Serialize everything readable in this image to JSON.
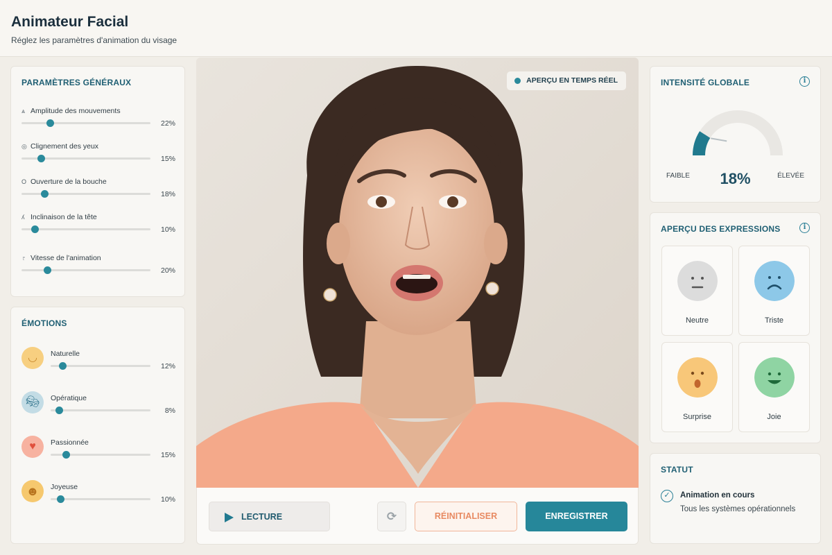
{
  "header": {
    "title": "Animateur Facial",
    "subtitle": "Réglez les paramètres d'animation du visage"
  },
  "general": {
    "title": "PARAMÈTRES GÉNÉRAUX",
    "params": [
      {
        "label": "Amplitude des mouvements",
        "value_text": "22%",
        "value": 22,
        "icon": "amplitude-icon"
      },
      {
        "label": "Clignement des yeux",
        "value_text": "15%",
        "value": 15,
        "icon": "eye-icon"
      },
      {
        "label": "Ouverture de la bouche",
        "value_text": "18%",
        "value": 18,
        "icon": "mouth-icon"
      },
      {
        "label": "Inclinaison de la tête",
        "value_text": "10%",
        "value": 10,
        "icon": "head-tilt-icon"
      },
      {
        "label": "Vitesse de l'animation",
        "value_text": "20%",
        "value": 20,
        "icon": "speed-icon"
      }
    ]
  },
  "emotions": {
    "title": "ÉMOTIONS",
    "items": [
      {
        "label": "Naturelle",
        "value_text": "12%",
        "value": 12,
        "icon": "smile-icon",
        "color": "#f7c875"
      },
      {
        "label": "Opératique",
        "value_text": "8%",
        "value": 8,
        "icon": "theater-masks-icon",
        "color": "#b9d6e0"
      },
      {
        "label": "Passionnée",
        "value_text": "15%",
        "value": 15,
        "icon": "heart-icon",
        "color": "#f6a58f"
      },
      {
        "label": "Joyeuse",
        "value_text": "10%",
        "value": 10,
        "icon": "grin-icon",
        "color": "#f7c46b"
      }
    ]
  },
  "viewer": {
    "badge": "APERÇU EN TEMPS RÉEL",
    "image_alt": "portrait-photo"
  },
  "controls": {
    "play": "LECTURE",
    "reset": "RÉINITIALISER",
    "save": "ENREGISTRER"
  },
  "intensity": {
    "title": "INTENSITÉ GLOBALE",
    "low": "FAIBLE",
    "high": "ÉLEVÉE",
    "value_text": "18%",
    "value": 18
  },
  "expressions": {
    "title": "APERÇU DES EXPRESSIONS",
    "items": [
      {
        "label": "Neutre",
        "color": "#dcdcdc",
        "icon": "neutral-face-icon"
      },
      {
        "label": "Triste",
        "color": "#8dc8e8",
        "icon": "sad-face-icon"
      },
      {
        "label": "Surprise",
        "color": "#f8c779",
        "icon": "surprised-face-icon"
      },
      {
        "label": "Joie",
        "color": "#8fd4a3",
        "icon": "happy-face-icon"
      }
    ]
  },
  "status": {
    "title": "STATUT",
    "state": "Animation en cours",
    "detail": "Tous les systèmes opérationnels"
  },
  "colors": {
    "accent": "#26879a",
    "reset": "#e88a62",
    "title": "#1f5f73"
  }
}
